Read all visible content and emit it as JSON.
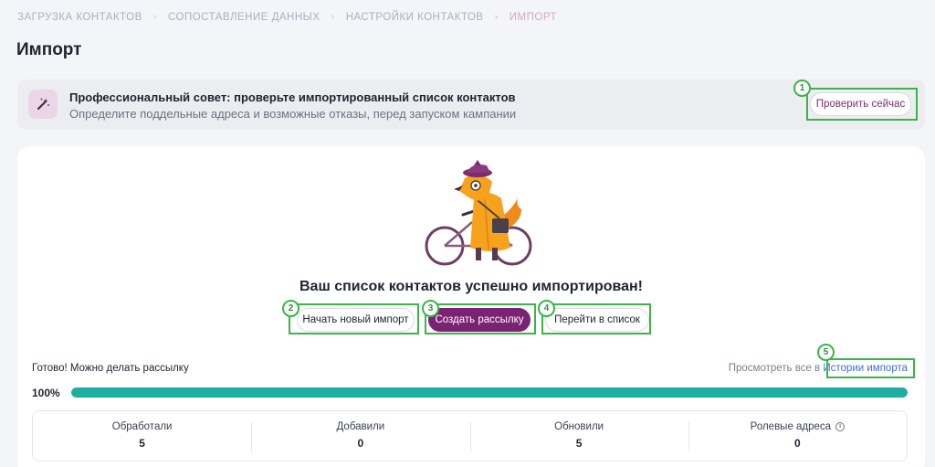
{
  "breadcrumb": [
    "ЗАГРУЗКА КОНТАКТОВ",
    "СОПОСТАВЛЕНИЕ ДАННЫХ",
    "НАСТРОЙКИ КОНТАКТОВ",
    "ИМПОРТ"
  ],
  "page_title": "Импорт",
  "tip": {
    "icon": "magic-wand-icon",
    "title": "Профессиональный совет: проверьте импортированный список контактов",
    "subtitle": "Определите поддельные адреса и возможные отказы, перед запуском кампании",
    "button": "Проверить сейчас"
  },
  "success_title": "Ваш список контактов успешно импортирован!",
  "actions": {
    "new_import": "Начать новый импорт",
    "create_campaign": "Создать рассылку",
    "go_to_list": "Перейти в список"
  },
  "status": {
    "ready_text": "Готово! Можно делать рассылку",
    "history_prefix": "Просмотреть все в ",
    "history_link": "Истории импорта",
    "progress_label": "100%",
    "progress": 1.0
  },
  "stats": [
    {
      "label": "Обработали",
      "value": "5"
    },
    {
      "label": "Добавили",
      "value": "0"
    },
    {
      "label": "Обновили",
      "value": "5"
    },
    {
      "label": "Ролевые адреса",
      "value": "0",
      "info": true
    }
  ],
  "annotations": [
    "1",
    "2",
    "3",
    "4",
    "5"
  ],
  "colors": {
    "accent": "#7a2373",
    "progress": "#1fafa0",
    "highlight": "#3cb44a",
    "link": "#3d6fd1"
  }
}
